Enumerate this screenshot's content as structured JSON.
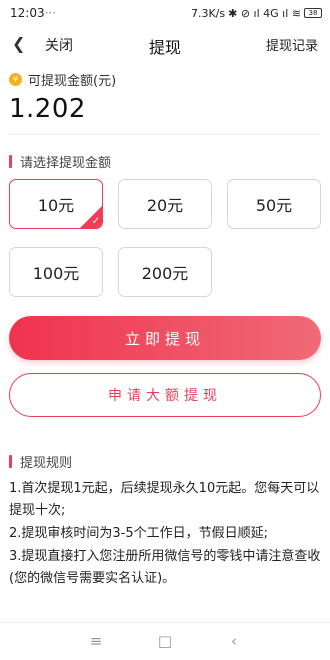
{
  "statusbar": {
    "time": "12:03",
    "dots": "···",
    "speed": "7.3K/s",
    "icons": "✱ ⊘ ıl 4G ıl ≋",
    "battery": "38"
  },
  "navbar": {
    "back_icon": "chevron-left-icon",
    "close_label": "关闭",
    "title": "提现",
    "record_label": "提现记录"
  },
  "balance": {
    "coin_icon": "¥",
    "label": "可提现金额(元)",
    "value": "1.202"
  },
  "select_section": {
    "title": "请选择提现金额",
    "accent_color": "#ef3d58"
  },
  "amounts": [
    {
      "label": "10元",
      "selected": true
    },
    {
      "label": "20元",
      "selected": false
    },
    {
      "label": "50元",
      "selected": false
    },
    {
      "label": "100元",
      "selected": false
    },
    {
      "label": "200元",
      "selected": false
    }
  ],
  "buttons": {
    "withdraw_now": "立即提现",
    "apply_large": "申请大额提现"
  },
  "rules": {
    "title": "提现规则",
    "items": [
      "1.首次提现1元起，后续提现永久10元起。您每天可以提现十次;",
      "2.提现审核时间为3-5个工作日，节假日顺延;",
      "3.提现直接打入您注册所用微信号的零钱中请注意查收(您的微信号需要实名认证)。"
    ]
  },
  "bottom_nav": {
    "menu": "≡",
    "home": "□",
    "back": "‹"
  }
}
